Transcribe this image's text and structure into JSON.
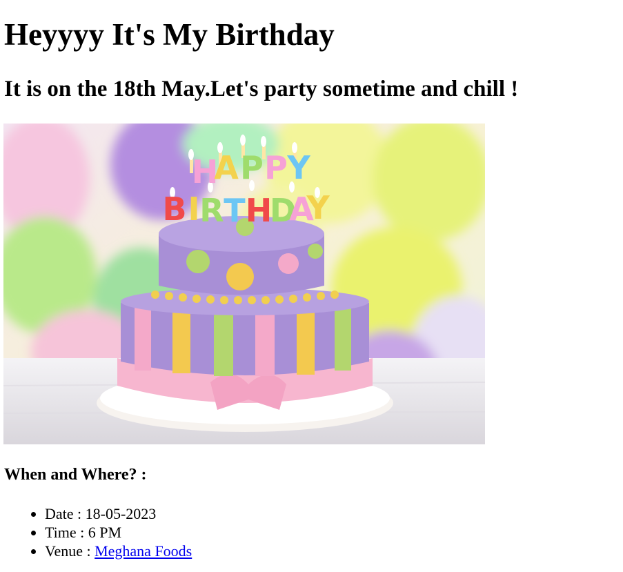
{
  "heading": "Heyyyy It's My Birthday",
  "subheading": "It is on the 18th May.Let's party sometime and chill !",
  "image": {
    "candle_letters_top": "HAPPY",
    "candle_letters_bottom": "BIRTHDAY",
    "colors": {
      "balloon_purple": "#b48ee0",
      "balloon_yellow": "#e9f26a",
      "balloon_green": "#9fe07a",
      "balloon_pink": "#f6b8d2",
      "cake_purple": "#a88fd6",
      "stripe_pink": "#f4a9c9",
      "stripe_yellow": "#f3c94f",
      "stripe_green": "#b3d66e",
      "ribbon_pink": "#f7b6cf",
      "table": "#ece9ee"
    }
  },
  "section_title": "When and Where? :",
  "details": {
    "date_label": "Date : ",
    "date_value": "18-05-2023",
    "time_label": "Time : ",
    "time_value": "6 PM",
    "venue_label": "Venue : ",
    "venue_link": "Meghana Foods"
  },
  "link_color": "#0000ee"
}
